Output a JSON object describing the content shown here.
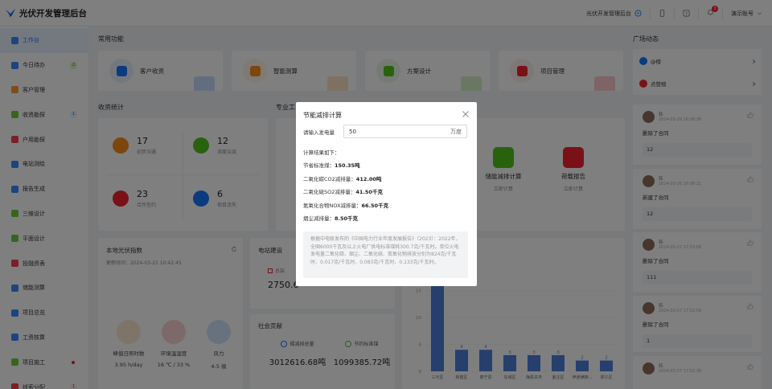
{
  "header": {
    "app_title": "光伏开发管理后台",
    "system_label": "光伏开发管理后台",
    "notification_count": "3",
    "account_label": "演示账号"
  },
  "sidebar": {
    "items": [
      {
        "label": "工作台",
        "color": "#1677ff",
        "active": true
      },
      {
        "label": "今日待办",
        "color": "#1677ff",
        "badge": "2",
        "badge_type": "green"
      },
      {
        "label": "客户管理",
        "color": "#fa8c16"
      },
      {
        "label": "收资勘探",
        "color": "#52c41a",
        "badge": "1",
        "badge_type": "blue"
      },
      {
        "label": "户用勘探",
        "color": "#f5222d"
      },
      {
        "label": "电站测绘",
        "color": "#1677ff"
      },
      {
        "label": "报告生成",
        "color": "#1677ff"
      },
      {
        "label": "三维设计",
        "color": "#52c41a"
      },
      {
        "label": "平面设计",
        "color": "#52c41a"
      },
      {
        "label": "投融资表",
        "color": "#f5222d"
      },
      {
        "label": "储能测算",
        "color": "#1677ff"
      },
      {
        "label": "项目总览",
        "color": "#1677ff"
      },
      {
        "label": "工资核算",
        "color": "#1677ff"
      },
      {
        "label": "项目施工",
        "color": "#52c41a",
        "dot": true
      },
      {
        "label": "线索分配",
        "color": "#f5222d",
        "badge": "1",
        "badge_type": "red"
      }
    ]
  },
  "common_functions": {
    "title": "常用功能",
    "items": [
      {
        "label": "客户收资",
        "color": "#1677ff",
        "bg": "#e6f0ff"
      },
      {
        "label": "智能测算",
        "color": "#fa8c16",
        "bg": "#fff4e6"
      },
      {
        "label": "方案设计",
        "color": "#52c41a",
        "bg": "#eaf7e6"
      },
      {
        "label": "项目管理",
        "color": "#f5222d",
        "bg": "#ffecec"
      }
    ]
  },
  "income_stats": {
    "title": "收资统计",
    "items": [
      {
        "value": "17",
        "label": "初步沟通",
        "color": "#fa8c16"
      },
      {
        "value": "12",
        "label": "深度治谈",
        "color": "#52c41a"
      },
      {
        "value": "23",
        "label": "合作签约",
        "color": "#f5222d"
      },
      {
        "value": "6",
        "label": "项目流失",
        "color": "#1677ff"
      }
    ]
  },
  "pro_tools": {
    "title": "专业工",
    "items": [
      {
        "label": "储能减排计算",
        "action": "立即计算",
        "color": "#52c41a"
      },
      {
        "label": "荷载报告",
        "action": "立即计算",
        "color": "#f5222d"
      }
    ]
  },
  "pv_index": {
    "title": "本地光伏指数",
    "update_label": "更新时间：2024-03-21 10:42:45",
    "metrics": [
      {
        "label": "峰值日照时数",
        "value": "3.95 h/day",
        "color": "#fa8c16"
      },
      {
        "label": "环境温湿度",
        "value": "16 ℃ / 33 %",
        "color": "#f5222d"
      },
      {
        "label": "风力",
        "value": "4-5 级",
        "color": "#1677ff"
      }
    ]
  },
  "station_build": {
    "title": "电站建设",
    "total_label": "总装",
    "value": "2750.6"
  },
  "social": {
    "title": "社会贡献",
    "items": [
      {
        "label": "碳减排总量",
        "value": "3012616.68吨",
        "color": "#1677ff"
      },
      {
        "label": "节约标准煤",
        "value": "1099385.72吨",
        "color": "#52c41a"
      }
    ]
  },
  "chart_data": {
    "type": "bar",
    "categories": [
      "三元区",
      "新建区",
      "泰宁县",
      "东城区",
      "梅县关市",
      "夏汪区",
      "伊通满族...",
      "梁江区"
    ],
    "values": [
      68,
      4,
      4,
      3,
      3,
      3,
      2,
      2
    ],
    "ylim": [
      0,
      20
    ],
    "yticks": [
      0,
      5,
      10,
      15
    ],
    "color": "#4e7fd9"
  },
  "plaza": {
    "title": "广场动态",
    "links": [
      {
        "label": "@榜",
        "color": "#1677ff"
      },
      {
        "label": "点赞榜",
        "color": "#f5222d"
      }
    ],
    "feeds": [
      {
        "name": "韩",
        "time": "2024-03-29 16:08:38",
        "action": "删除了合同",
        "value": "12"
      },
      {
        "name": "韩",
        "time": "2024-03-26 16:08:21",
        "action": "新建了合同",
        "value": "12"
      },
      {
        "name": "韩",
        "time": "2024-03-27 17:53:08",
        "action": "删除了合同",
        "value": "111"
      },
      {
        "name": "韩",
        "time": "2024-03-27 17:52:58",
        "action": "删除了合同",
        "value": "1"
      },
      {
        "name": "韩",
        "time": "2024-03-27 17:52:38",
        "action": "",
        "value": ""
      }
    ]
  },
  "modal": {
    "title": "节能减排计算",
    "input_label": "请输入发电量",
    "input_value": "50",
    "input_unit": "万度",
    "result_title": "计算结果如下：",
    "results": [
      {
        "label": "节省标准煤：",
        "value": "150.35吨"
      },
      {
        "label": "二氧化碳CO2减排量：",
        "value": "412.00吨"
      },
      {
        "label": "二氧化硫SO2减排量：",
        "value": "41.50千克"
      },
      {
        "label": "氮氧化合物NOX减排量：",
        "value": "66.50千克"
      },
      {
        "label": "烟尘减排量：",
        "value": "8.50千克"
      }
    ],
    "note": "根据中电联发布的《中国电力行业年度发展报告》（2023）：2022年，全国6000千瓦及以上火电厂供电标准煤耗300.7克/千瓦时。单位火电发电量二氧化碳、烟尘、二氧化硫、氮氧化物排放分别为824克/千瓦时、0.017克/千瓦时、0.083克/千瓦时、0.133克/千瓦时。"
  }
}
